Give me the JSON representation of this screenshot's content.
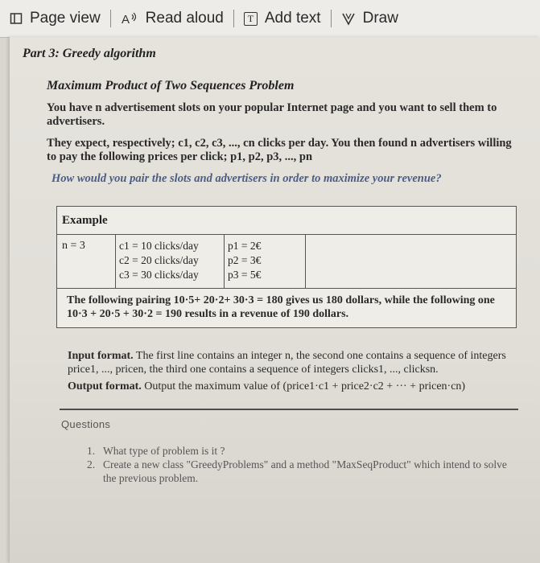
{
  "toolbar": {
    "page_view": "Page view",
    "read_aloud": "Read aloud",
    "add_text": "Add text",
    "draw": "Draw"
  },
  "doc": {
    "part_title": "Part 3: Greedy algorithm",
    "problem_title": "Maximum Product of Two Sequences Problem",
    "para1": "You have n advertisement slots on your popular Internet page and you want to sell them to advertisers.",
    "para2": "They expect, respectively; c1, c2, c3, ..., cn clicks per day. You then found n advertisers willing to pay the following prices per click; p1, p2, p3, ..., pn",
    "question": "How would you pair the slots and advertisers in order to maximize your revenue?",
    "example": {
      "header": "Example",
      "n": "n = 3",
      "clicks": [
        "c1 = 10 clicks/day",
        "c2 = 20 clicks/day",
        "c3 = 30 clicks/day"
      ],
      "prices": [
        "p1 = 2€",
        "p2 = 3€",
        "p3 = 5€"
      ],
      "explanation": "The following pairing 10·5+ 20·2+ 30·3 = 180 gives us 180 dollars, while the following one 10·3 + 20·5 + 30·2 = 190 results in a revenue of 190 dollars."
    },
    "input_label": "Input format.",
    "input_text": " The first line contains an integer n, the second one contains a sequence of integers price1, ..., pricen, the third one contains a sequence of integers clicks1, ..., clicksn.",
    "output_label": "Output format.",
    "output_text": " Output the maximum value of (price1·c1 + price2·c2 + ··· + pricen·cn)",
    "questions_title": "Questions",
    "questions": [
      "What type of problem is it ?",
      "Create a new class \"GreedyProblems\" and a method \"MaxSeqProduct\" which intend to solve the previous problem."
    ]
  }
}
